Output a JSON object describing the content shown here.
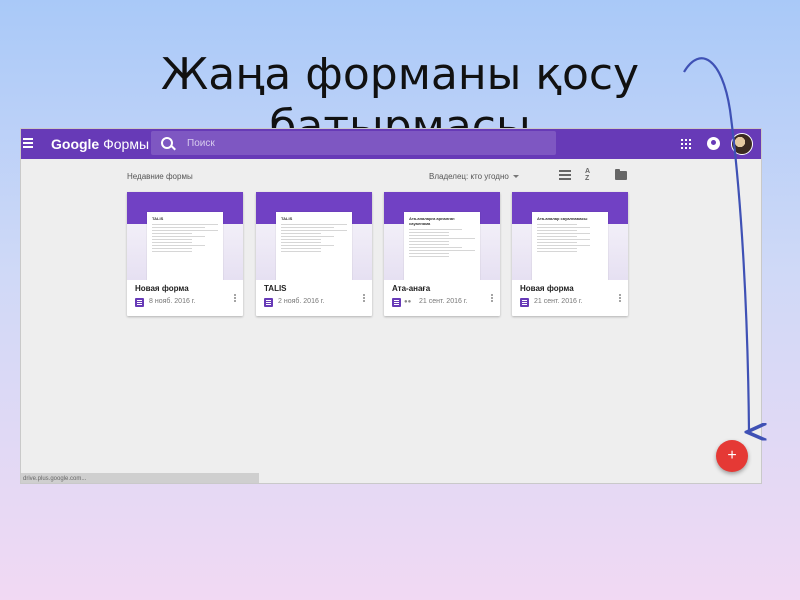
{
  "slide": {
    "title_line1": "Жаңа форманы қосу",
    "title_line2": "батырмасы"
  },
  "app": {
    "brand": "Google",
    "name": "Формы",
    "search_placeholder": "Поиск"
  },
  "toolbar": {
    "section_label": "Недавние формы",
    "owner_filter": "Владелец: кто угодно",
    "sort_label": "A\nZ"
  },
  "cards": [
    {
      "title": "Новая форма",
      "date": "8 нояб. 2016 г.",
      "preview_title": "TALIS"
    },
    {
      "title": "TALIS",
      "date": "2 нояб. 2016 г.",
      "preview_title": "TALIS"
    },
    {
      "title": "Ата-анаға",
      "date": "21 сент. 2016 г.",
      "preview_title": "Ата-аналарға арналған сауалнама"
    },
    {
      "title": "Новая форма",
      "date": "21 сент. 2016 г.",
      "preview_title": "Ата-аналар сауалнамасы"
    }
  ],
  "fab": {
    "label": "+"
  },
  "status_bar": {
    "text": "drive.plus.google.com..."
  },
  "colors": {
    "primary": "#673ab7",
    "fab": "#e53935",
    "arrow": "#3f51b5"
  },
  "icons": [
    "menu-icon",
    "search-icon",
    "apps-icon",
    "account-icon",
    "list-view-icon",
    "sort-icon",
    "folder-icon",
    "form-icon",
    "shared-icon",
    "more-icon",
    "add-icon"
  ]
}
